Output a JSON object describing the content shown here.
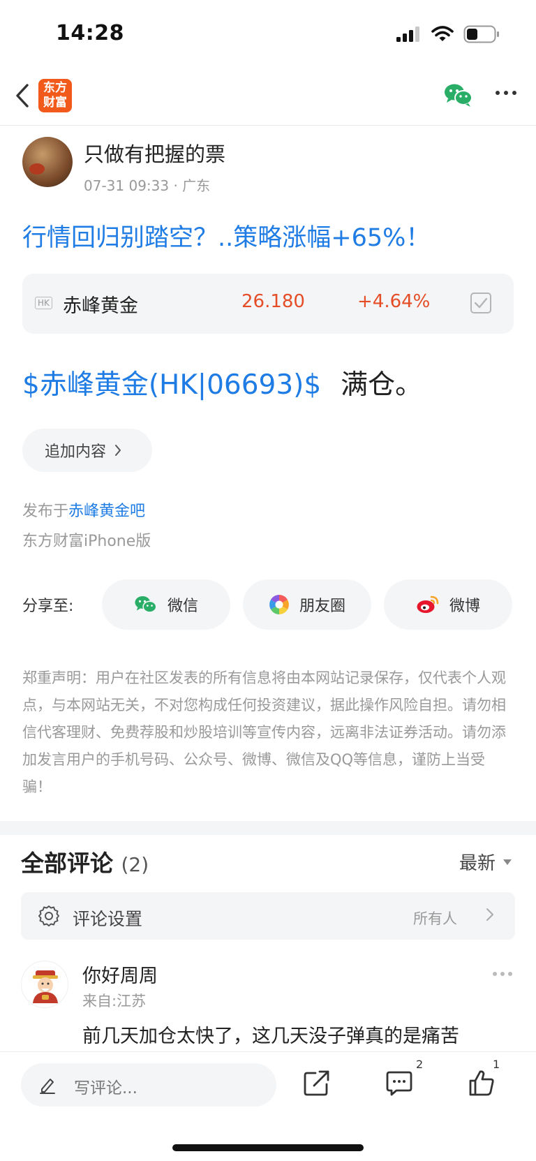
{
  "status_bar": {
    "time": "14:28"
  },
  "nav": {
    "logo_line1": "东方",
    "logo_line2": "财富"
  },
  "author": {
    "name": "只做有把握的票",
    "meta": "07-31 09:33 · 广东"
  },
  "post": {
    "title": "行情回归别踏空？..策略涨幅+65%！",
    "body_link": "$赤峰黄金(HK|06693)$",
    "body_text": "满仓。"
  },
  "stock": {
    "market_badge": "HK",
    "name": "赤峰黄金",
    "price": "26.180",
    "change": "+4.64%",
    "accent_color": "#e54d26"
  },
  "append": {
    "label": "追加内容"
  },
  "published": {
    "prefix": "发布于",
    "bar_name": "赤峰黄金吧",
    "client": "东方财富iPhone版"
  },
  "share": {
    "label": "分享至:",
    "wechat": "微信",
    "moments": "朋友圈",
    "weibo": "微博"
  },
  "disclaimer": "郑重声明：用户在社区发表的所有信息将由本网站记录保存，仅代表个人观点，与本网站无关，不对您构成任何投资建议，据此操作风险自担。请勿相信代客理财、免费荐股和炒股培训等宣传内容，远离非法证券活动。请勿添加发言用户的手机号码、公众号、微博、微信及QQ等信息，谨防上当受骗！",
  "comments": {
    "heading": "全部评论",
    "count": "(2)",
    "sort": "最新",
    "settings_label": "评论设置",
    "settings_value": "所有人",
    "items": [
      {
        "name": "你好周周",
        "location": "来自:江苏",
        "text": "前几天加仓太快了，这几天没子弹真的是痛苦"
      }
    ]
  },
  "bottom_bar": {
    "write_placeholder": "写评论...",
    "comment_count": "2",
    "like_count": "1"
  },
  "colors": {
    "link_blue": "#1e7ce4",
    "brand_orange": "#f25a1c",
    "wechat_green": "#2aae67"
  }
}
